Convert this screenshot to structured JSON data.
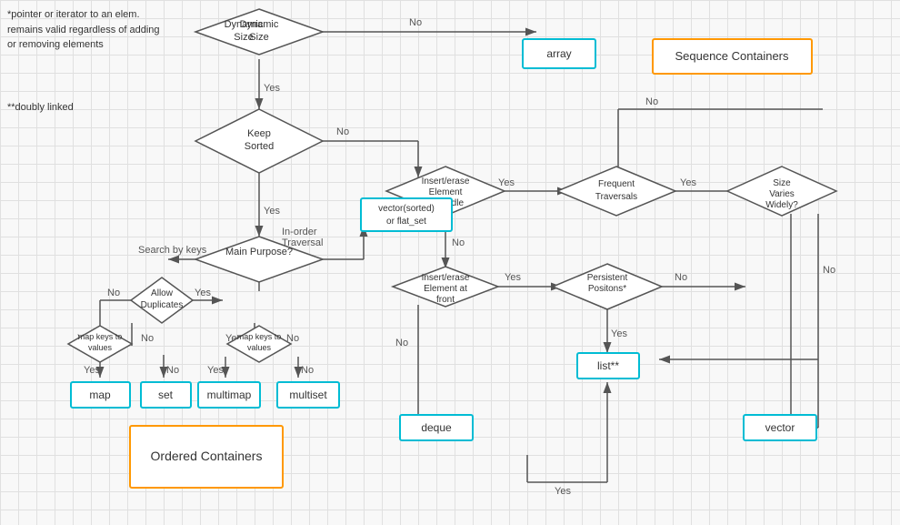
{
  "notes": {
    "pointer_note": "*pointer or iterator to an elem. remains valid regardless of adding or removing elements",
    "doubly_note": "**doubly linked"
  },
  "boxes": {
    "array": "array",
    "sequence_containers": "Sequence Containers",
    "vector_sorted": "vector(sorted)\nor flat_set",
    "map": "map",
    "set": "set",
    "multimap": "multimap",
    "multiset": "multiset",
    "list": "list**",
    "deque": "deque",
    "vector": "vector",
    "ordered_containers": "Ordered Containers"
  },
  "diamonds": {
    "dynamic_size": "Dynamic\nSize",
    "keep_sorted": "Keep\nSorted",
    "main_purpose": "Main Purpose?",
    "insert_erase_middle": "Insert/erase\nElement\nin middle",
    "frequent_traversals": "Frequent\nTraversals",
    "allow_duplicates": "Allow\nDuplicates",
    "map_keys_values1": "map keys to\nvalues",
    "map_keys_values2": "map keys to\nvalues",
    "insert_erase_front": "Insert/erase\nElement at\nfront",
    "persistent_positions": "Persistent\nPositons*",
    "size_varies_widely": "Size\nVaries\nWidely?"
  },
  "labels": {
    "yes": "Yes",
    "no": "No",
    "inorder_traversal": "In-order\nTraversal"
  },
  "colors": {
    "cyan_border": "#00bcd4",
    "orange_border": "#ff9800",
    "diamond_fill": "#ffffff",
    "box_fill": "#ffffff",
    "arrow": "#555555"
  }
}
